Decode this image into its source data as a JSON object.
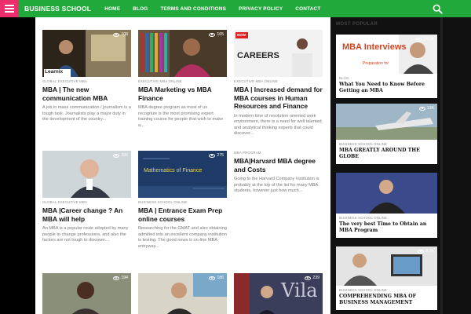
{
  "brand": "BUSINESS SCHOOL",
  "nav": [
    "HOME",
    "BLOG",
    "TERMS AND CONDITIONS",
    "PRIVACY POLICY",
    "CONTACT"
  ],
  "posts": [
    {
      "views": "108",
      "category": "GLOBAL EXECUTIVE MBA",
      "title": "MBA | The new communication MBA",
      "excerpt": "A job in mass communication / journalism is a tough task. Journalists play a major duty in the development of the country...",
      "thumb_text": "Learnix"
    },
    {
      "views": "165",
      "category": "EXECUTIVE MBA ONLINE",
      "title": "MBA Marketing vs MBA Finance",
      "excerpt": "MBA degree program as most of us recognize is the most promising expert training course for people that wish to make a..."
    },
    {
      "views": "",
      "category": "EXECUTIVE MBA ONLINE",
      "title": "MBA | Increased demand for MBA courses in Human Resources and Finance",
      "excerpt": "In modern time of resolution oriented work environment, there is a need for well talented and analytical thinking experts that could discover...",
      "thumb_text": "CAREERS",
      "thumb_badge": "NOW"
    },
    {
      "views": "206",
      "category": "GLOBAL EXECUTIVE MBA",
      "title": "MBA |Career change ? An MBA will help",
      "excerpt": "An MBA is a popular route adopted by many people to change professions, and also the factors are not tough to discover...."
    },
    {
      "views": "275",
      "category": "BUSINESS SCHOOL ONLINE",
      "title": "MBA | Entrance Exam Prep online courses",
      "excerpt": "Researching for the GMAT and also obtaining admitted into an excellent company institution is testing. The good news is on-line MBA entryway...",
      "thumb_text": "Mathematics of Finance"
    },
    {
      "views": "",
      "category": "MBA PROGRAM",
      "title": "MBA|Harvard MBA degree and Costs",
      "excerpt": "Going to the Harvard Company Institution is probably at the top of the list for many MBA students, however just how much..."
    },
    {
      "views": "194",
      "category": "",
      "title": "",
      "excerpt": ""
    },
    {
      "views": "186",
      "category": "",
      "title": "",
      "excerpt": ""
    },
    {
      "views": "239",
      "category": "",
      "title": "",
      "excerpt": "",
      "thumb_text": "Vila"
    }
  ],
  "sidebar": {
    "heading": "MOST POPULAR",
    "items": [
      {
        "views": "14.2K",
        "category": "BLOG",
        "title": "What You Need to Know Before Getting an MBA",
        "thumb_text": "MBA Interviews",
        "thumb_sub": "Preparation for"
      },
      {
        "views": "13K",
        "category": "BUSINESS SCHOOL ONLINE",
        "title": "MBA GREATLY AROUND THE GLOBE"
      },
      {
        "views": "",
        "category": "BUSINESS SCHOOL ONLINE",
        "title": "The very best Time to Obtain an MBA Program"
      },
      {
        "views": "8.7K",
        "category": "BUSINESS SCHOOL ONLINE",
        "title": "COMPREHENDING MBA OF BUSINESS MANAGEMENT"
      }
    ]
  },
  "colors": {
    "nav": "#22a93c",
    "menu_button": "#ec2c6b"
  }
}
